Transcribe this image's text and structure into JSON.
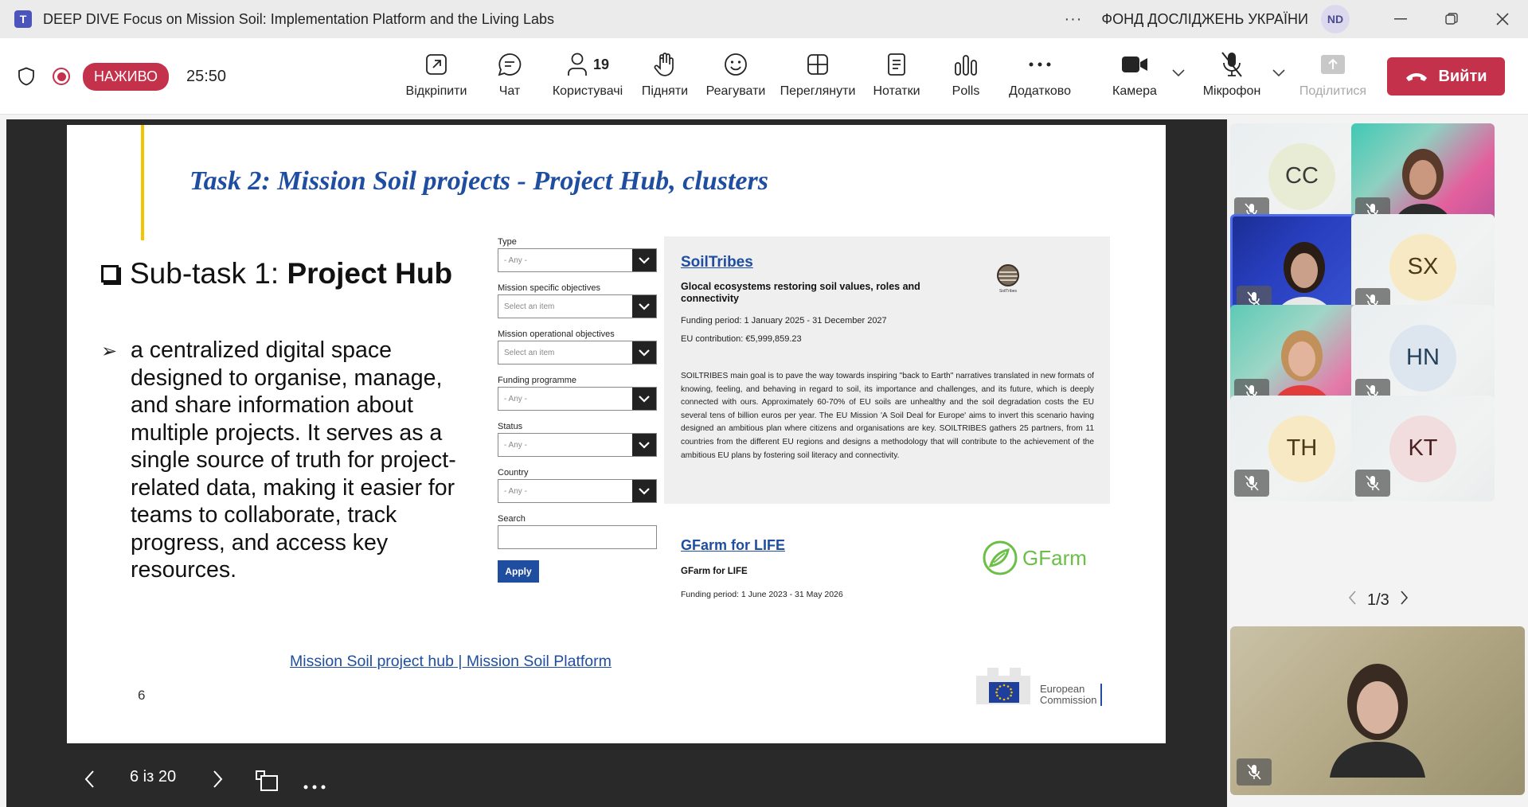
{
  "window": {
    "title": "DEEP DIVE Focus on Mission Soil: Implementation Platform and the Living Labs",
    "org": "ФОНД ДОСЛІДЖЕНЬ УКРАЇНИ",
    "user_initials": "ND"
  },
  "toolbar": {
    "live": "НАЖИВО",
    "timer": "25:50",
    "participants_count": "19",
    "items": {
      "popout": "Відкріпити",
      "chat": "Чат",
      "people": "Користувачі",
      "raise": "Підняти",
      "react": "Реагувати",
      "view": "Переглянути",
      "notes": "Нотатки",
      "polls": "Polls",
      "more": "Додатково",
      "camera": "Камера",
      "mic": "Мікрофон",
      "share": "Поділитися"
    },
    "leave": "Вийти"
  },
  "slide": {
    "title": "Task 2: Mission Soil projects - Project Hub, clusters",
    "subtask_prefix": "Sub-task 1: ",
    "subtask_bold": "Project Hub",
    "bullet": "a centralized digital space designed to organise, manage, and share information about multiple projects. It serves as a single source of truth for project-related data, making it easier for teams to collaborate, track progress, and access key resources.",
    "link": "Mission Soil project hub | Mission Soil Platform",
    "page_number": "6",
    "filters": [
      {
        "label": "Type",
        "value": "- Any -"
      },
      {
        "label": "Mission specific objectives",
        "value": "Select an item"
      },
      {
        "label": "Mission operational objectives",
        "value": "Select an item"
      },
      {
        "label": "Funding programme",
        "value": "- Any -"
      },
      {
        "label": "Status",
        "value": "- Any -"
      },
      {
        "label": "Country",
        "value": "- Any -"
      }
    ],
    "search_label": "Search",
    "apply": "Apply",
    "card1": {
      "title": "SoilTribes",
      "subtitle": "Glocal ecosystems restoring soil values, roles and connectivity",
      "funding": "Funding period: 1 January 2025 - 31 December 2027",
      "contribution": "EU contribution: €5,999,859.23",
      "description": "SOILTRIBES main goal is to pave the way towards inspiring \"back to Earth\" narratives translated in new formats of knowing, feeling, and behaving in regard to soil, its importance and challenges, and its future, which is deeply connected with ours. Approximately 60-70% of EU soils are unhealthy and the soil degradation costs the EU several tens of billion euros per year. The EU Mission 'A Soil Deal for Europe' aims to invert this scenario having designed an ambitious plan where citizens and organisations are key. SOILTRIBES gathers 25 partners, from 11 countries from the different EU regions and designs a methodology that will contribute to the achievement of the ambitious EU plans by fostering soil literacy and connectivity.",
      "logo_text": "SoilTribes"
    },
    "card2": {
      "title": "GFarm for LIFE",
      "subtitle": "GFarm for LIFE",
      "funding": "Funding period: 1 June 2023 - 31 May 2026",
      "logo_text": "GFarm"
    },
    "ec_logo": {
      "line1": "European",
      "line2": "Commission"
    }
  },
  "nav": {
    "position": "6 із 20"
  },
  "participants": [
    {
      "initials": "CC",
      "color": "#e8ecd5",
      "text_color": "#3a3a3a"
    },
    {
      "initials": "",
      "video": "a"
    },
    {
      "initials": "",
      "video": "b"
    },
    {
      "initials": "SX",
      "color": "#f7e9c4",
      "text_color": "#4a3a18"
    },
    {
      "initials": "",
      "video": "c"
    },
    {
      "initials": "HN",
      "color": "#dde6ef",
      "text_color": "#24405a"
    },
    {
      "initials": "TH",
      "color": "#f7e9c4",
      "text_color": "#4a3a18"
    },
    {
      "initials": "KT",
      "color": "#f1dddd",
      "text_color": "#4a2020"
    }
  ],
  "pager": {
    "text": "1/3"
  },
  "colors": {
    "brand_red": "#c4314b",
    "slide_blue": "#1f4ea1",
    "teams_purple": "#4b53bc"
  }
}
